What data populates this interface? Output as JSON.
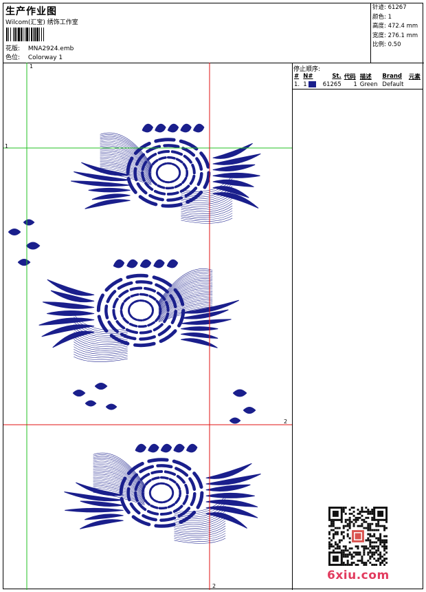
{
  "header": {
    "title": "生产作业图",
    "subtitle": "Wilcom(汇宝) 绣饰工作室",
    "design_label": "花版:",
    "design_value": "MNA2924.emb",
    "color_label": "色位:",
    "color_value": "Colorway 1"
  },
  "info": {
    "stitches": "针迹: 61267",
    "colors": "颜色: 1",
    "height": "高度: 472.4 mm",
    "width": "宽度: 276.1 mm",
    "scale": "比例: 0.50"
  },
  "stop_sequence": {
    "title": "停止顺序:",
    "columns": [
      "#",
      "N#",
      "St.",
      "代码",
      "描述",
      "Brand",
      "元素"
    ],
    "rows": [
      {
        "index": "1.",
        "n": "1",
        "stitches": "61265",
        "code": "1",
        "description": "Green",
        "brand": "Default",
        "element": "",
        "color": "#1a1f8c"
      }
    ]
  },
  "guides": {
    "h1": "1",
    "v1": "1",
    "h2": "2",
    "v2": "2",
    "guide1_color": "#22c022",
    "guide2_color": "#e01010"
  },
  "colors": {
    "thread": "#1a1f8c"
  },
  "watermark": "6xiu.com"
}
